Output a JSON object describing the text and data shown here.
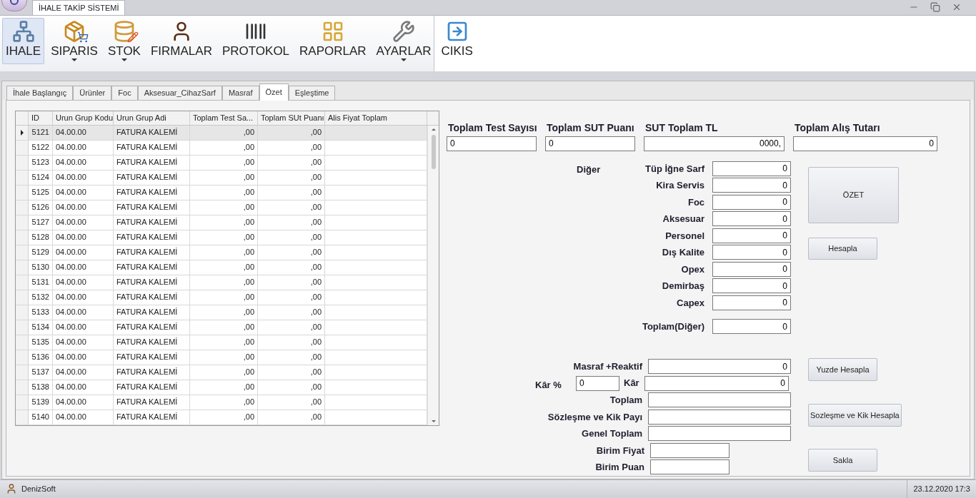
{
  "window": {
    "app_tab": "İHALE TAKİP SİSTEMİ"
  },
  "ribbon": [
    {
      "label": "IHALE",
      "selected": true,
      "has_menu": false
    },
    {
      "label": "SIPARIS",
      "selected": false,
      "has_menu": true
    },
    {
      "label": "STOK",
      "selected": false,
      "has_menu": true
    },
    {
      "label": "FIRMALAR",
      "selected": false,
      "has_menu": false
    },
    {
      "label": "PROTOKOL",
      "selected": false,
      "has_menu": false
    },
    {
      "label": "RAPORLAR",
      "selected": false,
      "has_menu": false
    },
    {
      "label": "AYARLAR",
      "selected": false,
      "has_menu": true
    },
    {
      "label": "CIKIS",
      "selected": false,
      "has_menu": false
    }
  ],
  "tabs": [
    {
      "label": "İhale Başlangıç",
      "selected": false
    },
    {
      "label": "Ürünler",
      "selected": false
    },
    {
      "label": "Foc",
      "selected": false
    },
    {
      "label": "Aksesuar_CihazSarf",
      "selected": false
    },
    {
      "label": "Masraf",
      "selected": false
    },
    {
      "label": "Özet",
      "selected": true
    },
    {
      "label": "Eşleştime",
      "selected": false
    }
  ],
  "grid": {
    "columns": [
      "ID",
      "Urun Grup Kodu",
      "Urun Grup Adi",
      "Toplam Test Sa...",
      "Toplam SUt Puanı",
      "Alis Fiyat Toplam"
    ],
    "rows": [
      {
        "selected": true,
        "cells": [
          "5121",
          "04.00.00",
          "FATURA KALEMİ",
          ",00",
          ",00"
        ]
      },
      {
        "selected": false,
        "cells": [
          "5122",
          "04.00.00",
          "FATURA KALEMİ",
          ",00",
          ",00"
        ]
      },
      {
        "selected": false,
        "cells": [
          "5123",
          "04.00.00",
          "FATURA KALEMİ",
          ",00",
          ",00"
        ]
      },
      {
        "selected": false,
        "cells": [
          "5124",
          "04.00.00",
          "FATURA KALEMİ",
          ",00",
          ",00"
        ]
      },
      {
        "selected": false,
        "cells": [
          "5125",
          "04.00.00",
          "FATURA KALEMİ",
          ",00",
          ",00"
        ]
      },
      {
        "selected": false,
        "cells": [
          "5126",
          "04.00.00",
          "FATURA KALEMİ",
          ",00",
          ",00"
        ]
      },
      {
        "selected": false,
        "cells": [
          "5127",
          "04.00.00",
          "FATURA KALEMİ",
          ",00",
          ",00"
        ]
      },
      {
        "selected": false,
        "cells": [
          "5128",
          "04.00.00",
          "FATURA KALEMİ",
          ",00",
          ",00"
        ]
      },
      {
        "selected": false,
        "cells": [
          "5129",
          "04.00.00",
          "FATURA KALEMİ",
          ",00",
          ",00"
        ]
      },
      {
        "selected": false,
        "cells": [
          "5130",
          "04.00.00",
          "FATURA KALEMİ",
          ",00",
          ",00"
        ]
      },
      {
        "selected": false,
        "cells": [
          "5131",
          "04.00.00",
          "FATURA KALEMİ",
          ",00",
          ",00"
        ]
      },
      {
        "selected": false,
        "cells": [
          "5132",
          "04.00.00",
          "FATURA KALEMİ",
          ",00",
          ",00"
        ]
      },
      {
        "selected": false,
        "cells": [
          "5133",
          "04.00.00",
          "FATURA KALEMİ",
          ",00",
          ",00"
        ]
      },
      {
        "selected": false,
        "cells": [
          "5134",
          "04.00.00",
          "FATURA KALEMİ",
          ",00",
          ",00"
        ]
      },
      {
        "selected": false,
        "cells": [
          "5135",
          "04.00.00",
          "FATURA KALEMİ",
          ",00",
          ",00"
        ]
      },
      {
        "selected": false,
        "cells": [
          "5136",
          "04.00.00",
          "FATURA KALEMİ",
          ",00",
          ",00"
        ]
      },
      {
        "selected": false,
        "cells": [
          "5137",
          "04.00.00",
          "FATURA KALEMİ",
          ",00",
          ",00"
        ]
      },
      {
        "selected": false,
        "cells": [
          "5138",
          "04.00.00",
          "FATURA KALEMİ",
          ",00",
          ",00"
        ]
      },
      {
        "selected": false,
        "cells": [
          "5139",
          "04.00.00",
          "FATURA KALEMİ",
          ",00",
          ",00"
        ]
      },
      {
        "selected": false,
        "cells": [
          "5140",
          "04.00.00",
          "FATURA KALEMİ",
          ",00",
          ",00"
        ]
      }
    ]
  },
  "totals": [
    {
      "label": "Toplam Test Sayısı",
      "value": "0"
    },
    {
      "label": "Toplam SUT Puanı",
      "value": "0"
    },
    {
      "label": "SUT Toplam TL",
      "value": "0000,"
    },
    {
      "label": "Toplam Alış Tutarı",
      "value": "0"
    }
  ],
  "other": {
    "heading": "Diğer",
    "fields": [
      {
        "label": "Tüp İğne Sarf",
        "value": "0"
      },
      {
        "label": "Kira Servis",
        "value": "0"
      },
      {
        "label": "Foc",
        "value": "0"
      },
      {
        "label": "Aksesuar",
        "value": "0"
      },
      {
        "label": "Personel",
        "value": "0"
      },
      {
        "label": "Dış Kalite",
        "value": "0"
      },
      {
        "label": "Opex",
        "value": "0"
      },
      {
        "label": "Demirbaş",
        "value": "0"
      },
      {
        "label": "Capex",
        "value": "0"
      }
    ],
    "total": {
      "label": "Toplam(Diğer)",
      "value": "0"
    }
  },
  "summary_buttons": [
    "ÖZET",
    "Hesapla"
  ],
  "calc": {
    "masraf": {
      "label": "Masraf +Reaktif",
      "value": "0"
    },
    "kar_percent": {
      "label": "Kâr %",
      "value": "0"
    },
    "kar": {
      "label": "Kâr",
      "value": "0"
    },
    "fields": [
      {
        "label": "Toplam",
        "kind": "wide"
      },
      {
        "label": "Sözleşme ve Kik Payı",
        "kind": "wide"
      },
      {
        "label": "Genel Toplam",
        "kind": "wide"
      },
      {
        "label": "Birim Fiyat",
        "kind": "short"
      },
      {
        "label": "Birim Puan",
        "kind": "short"
      }
    ]
  },
  "calc_buttons": [
    "Yuzde Hesapla",
    "Sozleşme ve Kik Hesapla",
    "Sakla"
  ],
  "status_bar": {
    "user": "DenizSoft",
    "datetime": "23.12.2020 17:3"
  }
}
